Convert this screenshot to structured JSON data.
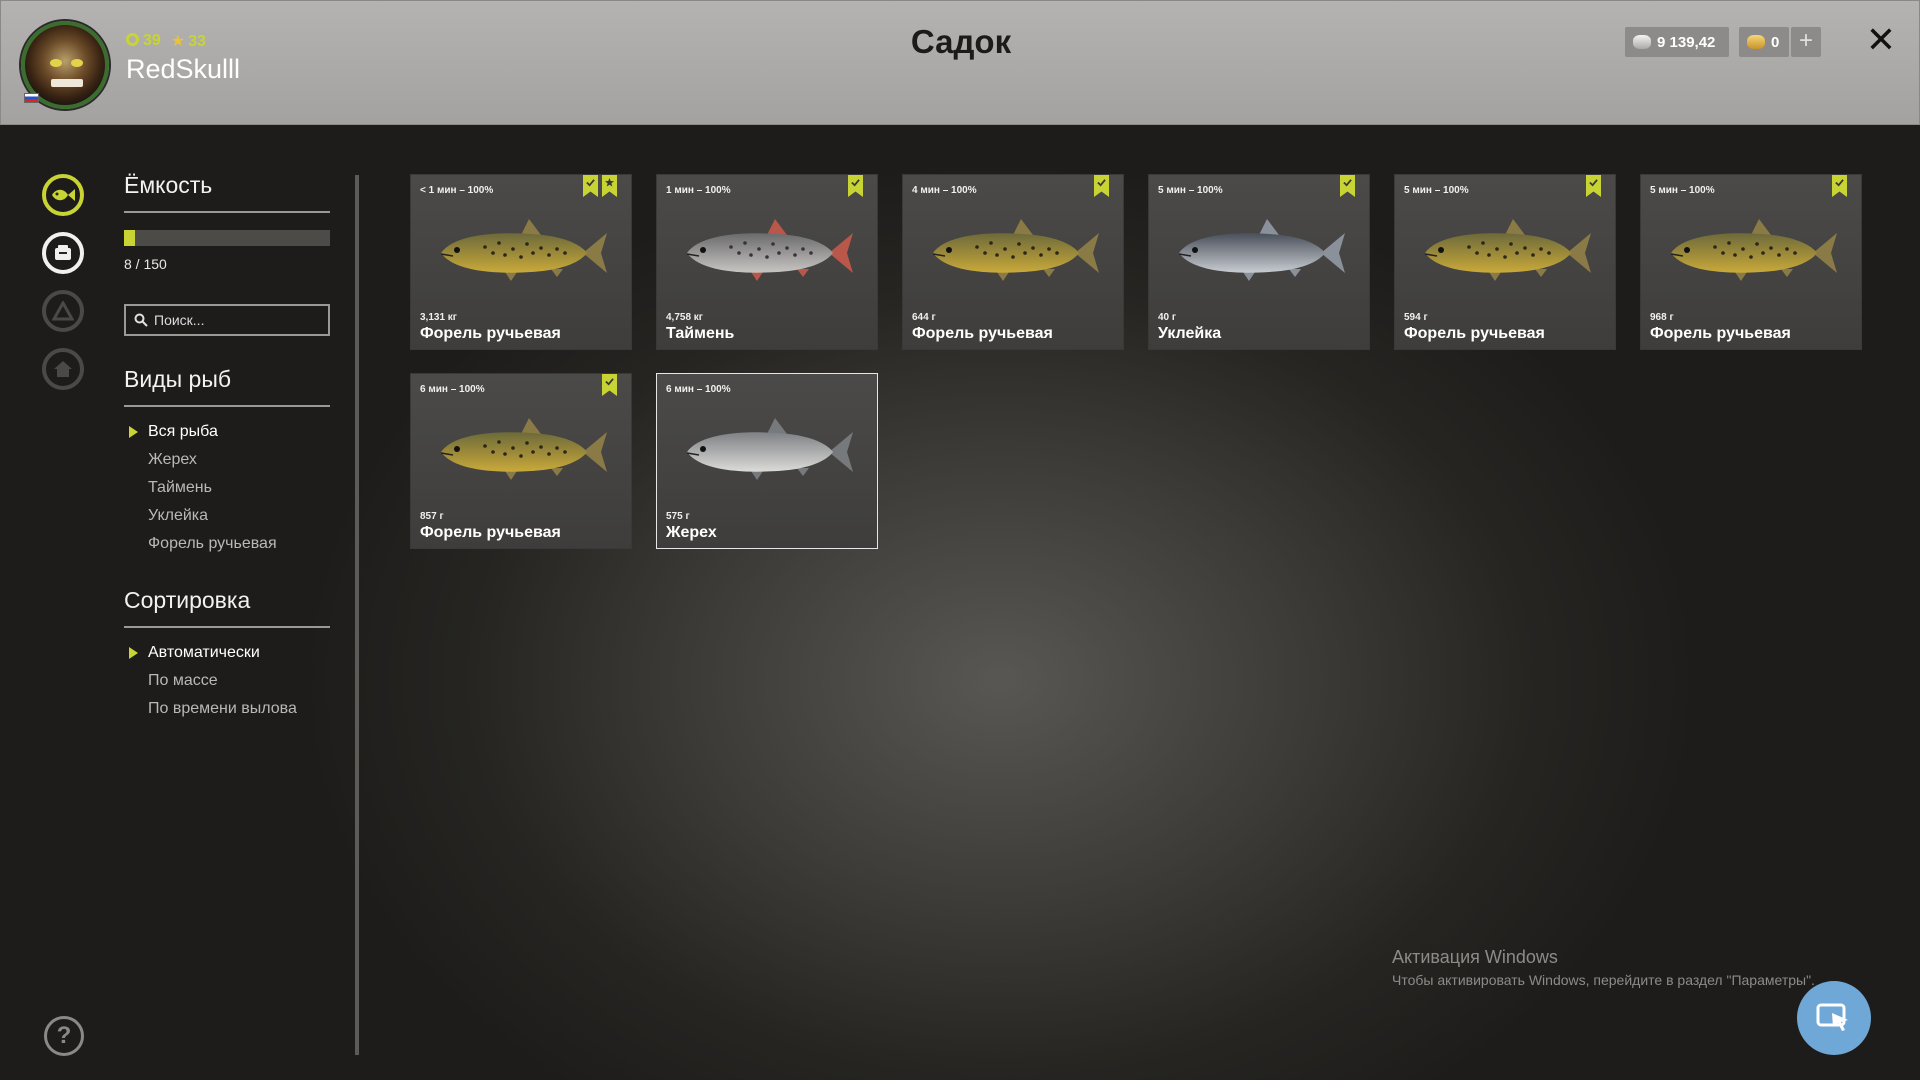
{
  "header": {
    "title": "Садок",
    "username": "RedSkulll",
    "level": "39",
    "rank": "33",
    "silver": "9 139,42",
    "gold": "0",
    "plus_label": "+",
    "close_label": "✕"
  },
  "sidebar": {
    "capacity_title": "Ёмкость",
    "capacity_text": "8 / 150",
    "capacity_fraction": 0.0533,
    "search_placeholder": "Поиск...",
    "species_title": "Виды рыб",
    "species": [
      "Вся рыба",
      "Жерех",
      "Таймень",
      "Уклейка",
      "Форель ручьевая"
    ],
    "species_selected": 0,
    "sort_title": "Сортировка",
    "sort": [
      "Автоматически",
      "По массе",
      "По времени вылова"
    ],
    "sort_selected": 0,
    "help_label": "?"
  },
  "fish": [
    {
      "time": "< 1 мин – 100%",
      "weight": "3,131 кг",
      "name": "Форель ручьевая",
      "kind": "trout",
      "bookmarks": [
        "check",
        "star"
      ]
    },
    {
      "time": "1 мин – 100%",
      "weight": "4,758 кг",
      "name": "Таймень",
      "kind": "taimen",
      "bookmarks": [
        "check"
      ]
    },
    {
      "time": "4 мин – 100%",
      "weight": "644 г",
      "name": "Форель ручьевая",
      "kind": "trout",
      "bookmarks": [
        "check"
      ]
    },
    {
      "time": "5 мин – 100%",
      "weight": "40 г",
      "name": "Уклейка",
      "kind": "bleak",
      "bookmarks": [
        "check"
      ]
    },
    {
      "time": "5 мин – 100%",
      "weight": "594 г",
      "name": "Форель ручьевая",
      "kind": "trout",
      "bookmarks": [
        "check"
      ]
    },
    {
      "time": "5 мин – 100%",
      "weight": "968 г",
      "name": "Форель ручьевая",
      "kind": "trout",
      "bookmarks": [
        "check"
      ]
    },
    {
      "time": "6 мин – 100%",
      "weight": "857 г",
      "name": "Форель ручьевая",
      "kind": "trout",
      "bookmarks": [
        "check"
      ]
    },
    {
      "time": "6 мин – 100%",
      "weight": "575 г",
      "name": "Жерех",
      "kind": "asp",
      "bookmarks": [],
      "selected": true
    }
  ],
  "overlay": {
    "activation_title": "Активация Windows",
    "activation_text": "Чтобы активировать Windows, перейдите в раздел \"Параметры\"."
  },
  "colors": {
    "accent": "#c8d433",
    "card_bg": "#4b4a48",
    "fab": "#6fa7d6"
  }
}
